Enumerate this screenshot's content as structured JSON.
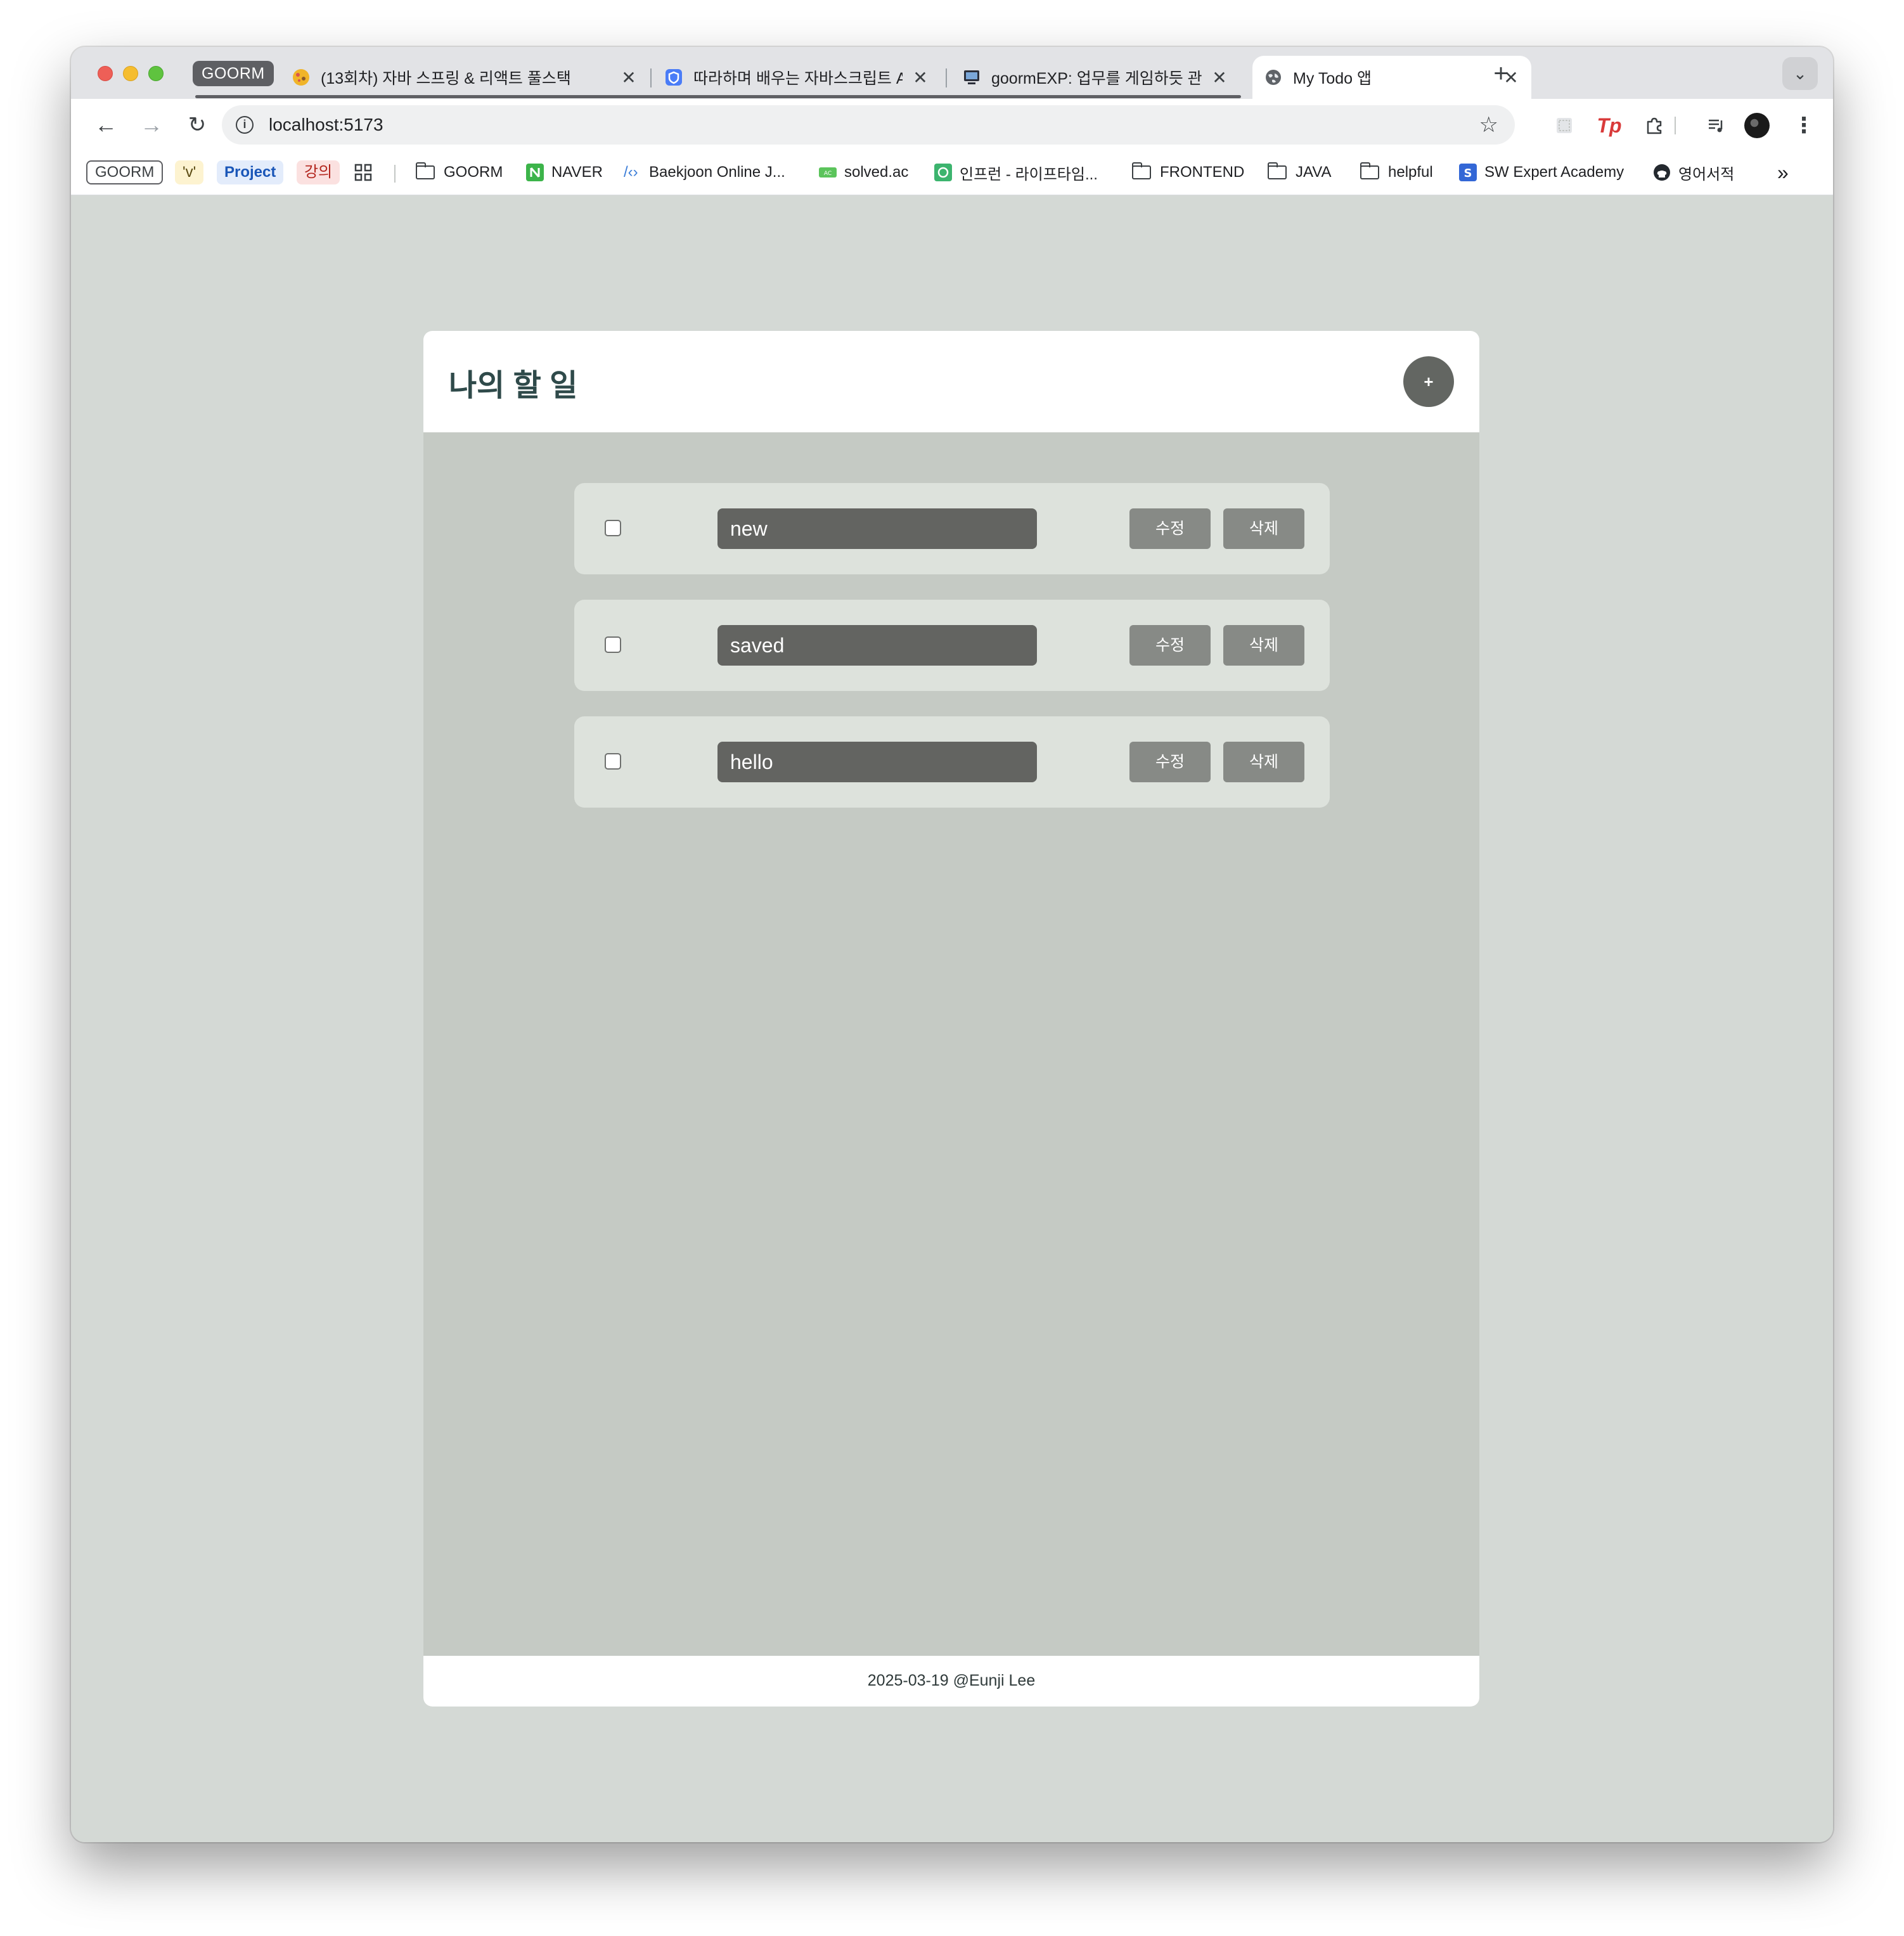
{
  "browser": {
    "tab_group": "GOORM",
    "tabs": [
      {
        "title": "(13회차) 자바 스프링 & 리액트 풀스택",
        "favicon": "cookie-icon"
      },
      {
        "title": "따라하며 배우는 자바스크립트 A-Z",
        "favicon": "shield-icon"
      },
      {
        "title": "goormEXP: 업무를 게임하듯 관리",
        "favicon": "monitor-icon"
      },
      {
        "title": "My Todo 앱",
        "favicon": "globe-icon",
        "active": true
      }
    ],
    "close_glyph": "✕",
    "new_tab_glyph": "+",
    "url": "localhost:5173",
    "bookmarks": [
      {
        "label": "GOORM",
        "kind": "group-chip"
      },
      {
        "label": "'v'",
        "kind": "group-chip"
      },
      {
        "label": "Project",
        "kind": "group-chip"
      },
      {
        "label": "강의",
        "kind": "group-chip"
      },
      {
        "label": "GOORM",
        "kind": "folder"
      },
      {
        "label": "NAVER",
        "kind": "site"
      },
      {
        "label": "Baekjoon Online J...",
        "kind": "site"
      },
      {
        "label": "solved.ac",
        "kind": "site"
      },
      {
        "label": "인프런 - 라이프타임...",
        "kind": "site"
      },
      {
        "label": "FRONTEND",
        "kind": "folder"
      },
      {
        "label": "JAVA",
        "kind": "folder"
      },
      {
        "label": "helpful",
        "kind": "folder"
      },
      {
        "label": "SW Expert Academy",
        "kind": "site"
      },
      {
        "label": "영어서적",
        "kind": "site"
      }
    ],
    "more_bookmarks_glyph": "»"
  },
  "app": {
    "title": "나의 할 일",
    "add_label": "+",
    "todos": [
      {
        "text": "new",
        "done": false,
        "edit_label": "수정",
        "delete_label": "삭제"
      },
      {
        "text": "saved",
        "done": false,
        "edit_label": "수정",
        "delete_label": "삭제"
      },
      {
        "text": "hello",
        "done": false,
        "edit_label": "수정",
        "delete_label": "삭제"
      }
    ],
    "footer": "2025-03-19 @Eunji Lee"
  },
  "colors": {
    "page_bg": "#d4d9d5",
    "card_body": "#c5cac4",
    "item_bg": "#dde2dc",
    "input_bg": "#636461",
    "button_bg": "#878a86",
    "title_color": "#2f4a4a",
    "add_button_bg": "#636662"
  }
}
